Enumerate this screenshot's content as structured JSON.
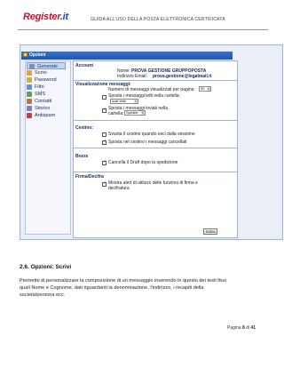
{
  "header": {
    "logo_text_main": "Register",
    "logo_text_dot": ".it",
    "logo_subtitle": "",
    "doc_title": "GUIDA ALL'USO DELLA POSTA ELETTRONICA CERTIFICATA"
  },
  "window": {
    "title": "Opzioni"
  },
  "menu": {
    "items": [
      {
        "label": "Generale",
        "icon": "gear-icon",
        "color": "#7c8fb5",
        "selected": true
      },
      {
        "label": "Scrivi",
        "icon": "pencil-icon",
        "color": "#e0a23a",
        "selected": false
      },
      {
        "label": "Password",
        "icon": "key-icon",
        "color": "#d0b040",
        "selected": false
      },
      {
        "label": "Filtri",
        "icon": "filter-icon",
        "color": "#6a8fd0",
        "selected": false
      },
      {
        "label": "SMS",
        "icon": "phone-icon",
        "color": "#5aa05a",
        "selected": false
      },
      {
        "label": "Contatti",
        "icon": "contacts-icon",
        "color": "#c07050",
        "selected": false
      },
      {
        "label": "Storico",
        "icon": "history-icon",
        "color": "#8080c0",
        "selected": false
      },
      {
        "label": "Antispam",
        "icon": "shield-icon",
        "color": "#c04040",
        "selected": false
      }
    ]
  },
  "account": {
    "title": "Account",
    "name_label": "Nome:",
    "name_value": "PROVA GESTIONE GRUPPOPOSTA",
    "email_label": "Indirizzo Email:",
    "email_value": "prova.gestione@legalmail.it"
  },
  "visualizzazione": {
    "title": "Visualizzazione messaggi:",
    "per_page_label": "Numero di messaggi visualizzati per pagina:",
    "per_page_value": "30",
    "read_label": "Sposta i messaggi letti nella cartella:",
    "read_value": "mail lette",
    "sent_label": "Sposta i messaggi inviati nella",
    "sent_label2": "cartella:",
    "sent_value": "Spedite"
  },
  "cestino": {
    "title": "Cestino:",
    "opt1": "Svuota il cestino quando esci dalla sessione",
    "opt2": "Sposta nel cestino i messaggi cancellati"
  },
  "bozze": {
    "title": "Bozze",
    "opt1": "Cancella il Draft dopo la spedizione"
  },
  "firma": {
    "title": "Firma/Decifra",
    "opt1": "Mostra alert di utilizzo delle funzioni di firma e",
    "opt1b": "decifratura"
  },
  "buttons": {
    "save": "Salva"
  },
  "body": {
    "section_heading": "2.6. Opzioni: Scrivi",
    "para_line1": "Permette di personalizzare la composizione di un messaggio inserendo in questo dei testi fissi",
    "para_line2": "quali Nome e Cognome, dati riguardanti la denominazione, l'indirizzo, i recapiti della",
    "para_line3": "società/persona ecc."
  },
  "footer": {
    "page_prefix": "Pagina",
    "page_current": "8",
    "page_of": "di",
    "page_total": "41"
  }
}
